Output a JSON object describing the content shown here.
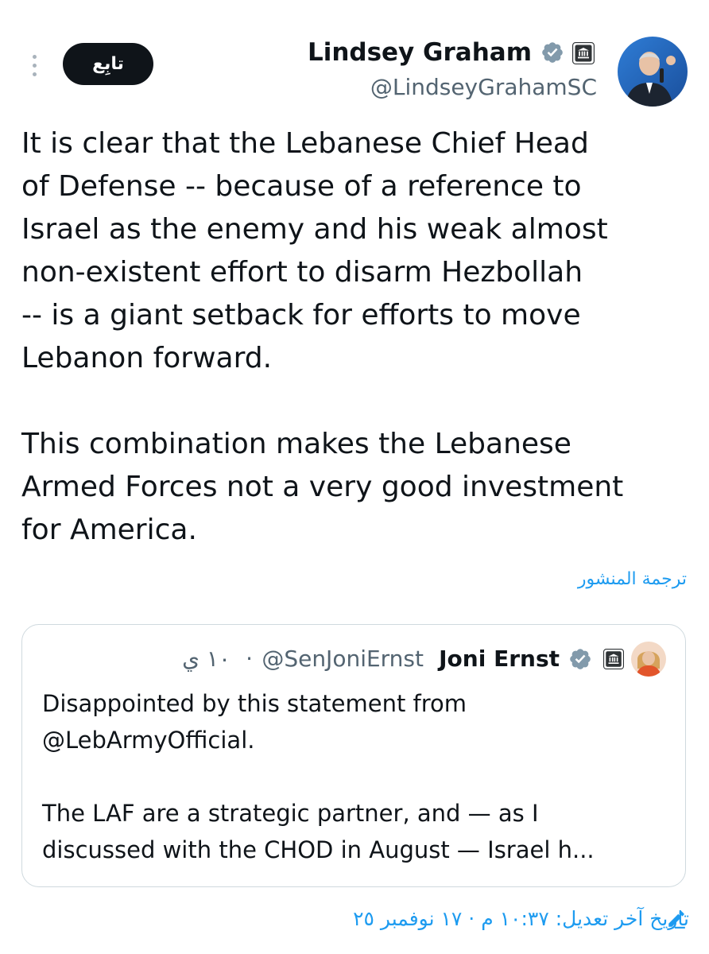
{
  "header": {
    "display_name": "Lindsey Graham",
    "handle": "@LindseyGrahamSC",
    "follow_label": "تابِع",
    "icons": {
      "more": "more-vertical-icon",
      "verified": "verified-badge-icon",
      "government": "government-building-icon"
    }
  },
  "tweet": {
    "text": "It is clear that the Lebanese Chief Head\nof Defense -- because of a reference to\nIsrael as the enemy and his weak almost\nnon-existent effort to disarm Hezbollah\n-- is a giant setback for efforts to move\nLebanon forward.\n\nThis combination makes the Lebanese\nArmed Forces not a very good investment\nfor America.",
    "translate_label": "ترجمة المنشور"
  },
  "quote": {
    "display_name": "Joni Ernst",
    "handle": "@SenJoniErnst",
    "separator": "·",
    "time": "١٠ ي",
    "text": "Disappointed by this statement from\n@LebArmyOfficial.\n\nThe LAF are a strategic partner, and — as I\ndiscussed with the CHOD in August — Israel h..."
  },
  "footer": {
    "edited_label": "تاريخ آخر تعديل: ١٠:٣٧ م · ١٧ نوفمبر ٢٥",
    "icon": "pencil-edit-icon"
  },
  "colors": {
    "text": "#0f1419",
    "muted": "#536471",
    "link": "#1d9bf0",
    "verified": "#829aab",
    "border": "#cfd9de",
    "follow_bg": "#0f1419"
  }
}
